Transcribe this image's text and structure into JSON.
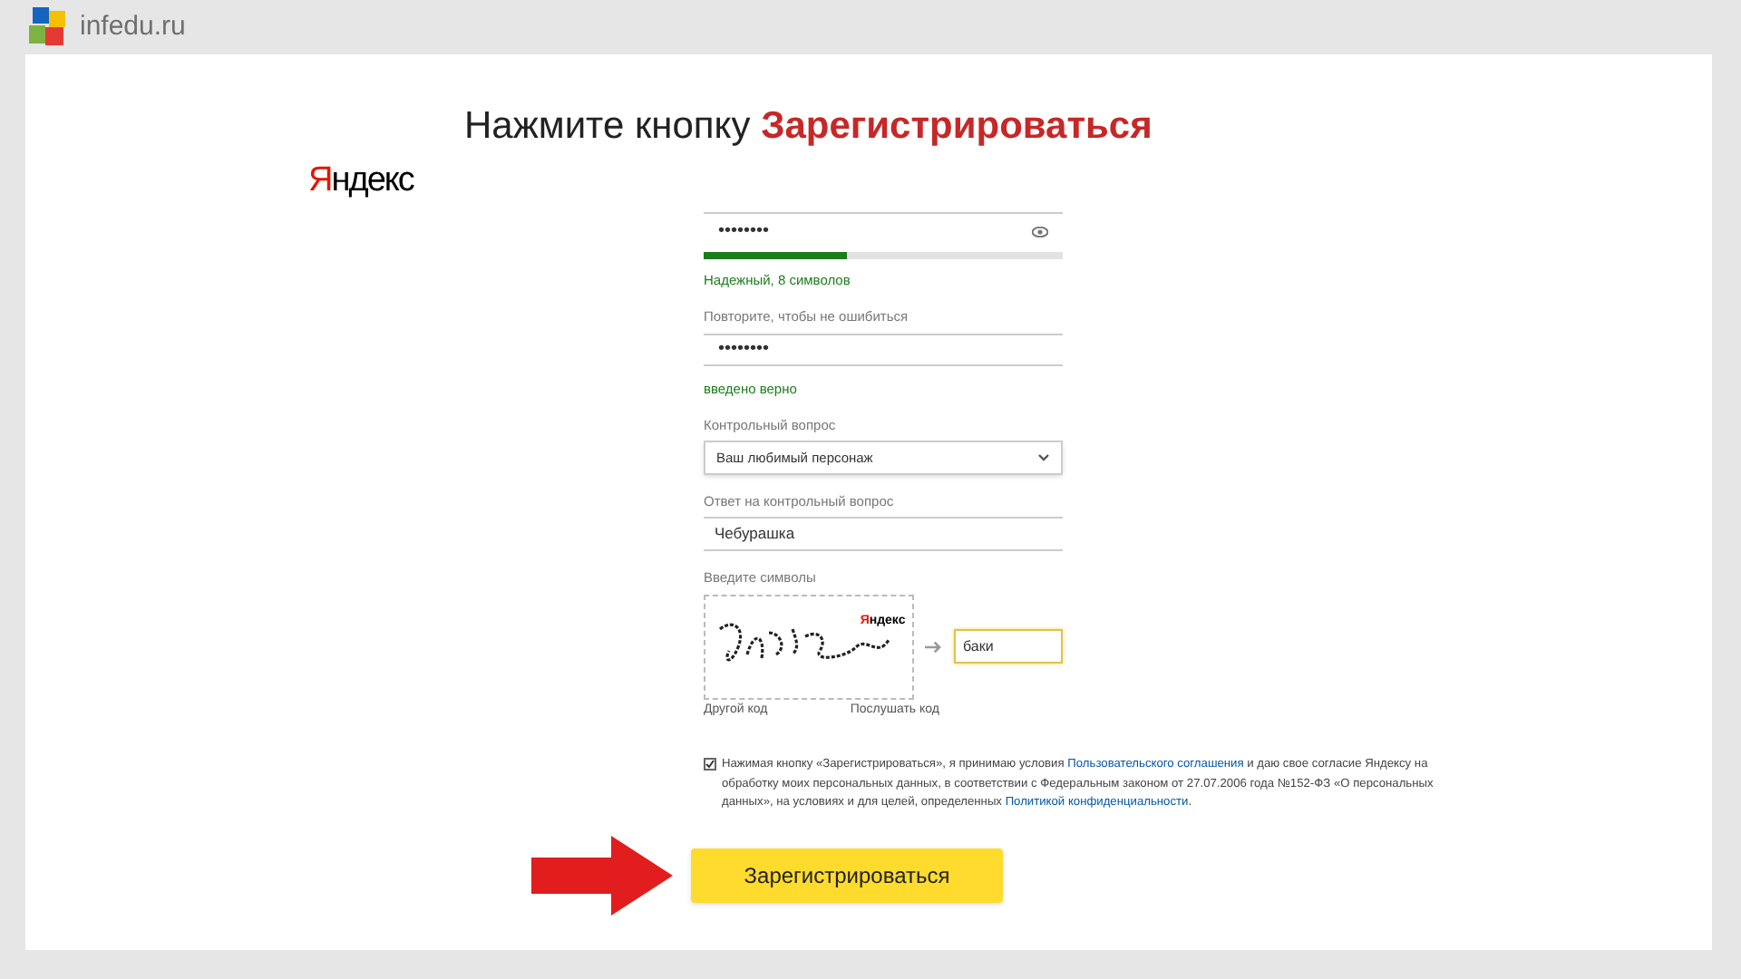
{
  "header": {
    "site": "infedu.ru"
  },
  "title": {
    "text": "Нажмите кнопку",
    "highlight": "Зарегистрироваться"
  },
  "logo": {
    "first": "Я",
    "rest": "ндекс"
  },
  "password": {
    "value": "••••••••",
    "level": 0.4,
    "hint": "Надежный, 8 символов"
  },
  "repeat": {
    "label": "Повторите, чтобы не ошибиться",
    "value": "••••••••",
    "hint": "введено верно"
  },
  "question": {
    "label": "Контрольный вопрос",
    "value": "Ваш любимый персонаж"
  },
  "answer": {
    "label": "Ответ на контрольный вопрос",
    "value": "Чебурашка"
  },
  "captcha": {
    "label": "Введите символы",
    "mark_first": "Я",
    "mark_rest": "ндекс",
    "value": "баки",
    "links": [
      "Другой код",
      "Послушать код"
    ]
  },
  "agreement": {
    "checked": true,
    "parts": [
      "Нажимая кнопку «Зарегистрироваться», я принимаю условия ",
      "Пользовательского соглашения",
      " и даю свое согласие Яндексу на обработку моих персональных данных, в соответствии с Федеральным законом от 27.07.2006 года №152-ФЗ «О персональных данных», на условиях и для целей, определенных ",
      "Политикой конфиденциальности",
      "."
    ]
  },
  "submit": {
    "label": "Зарегистрироваться"
  }
}
